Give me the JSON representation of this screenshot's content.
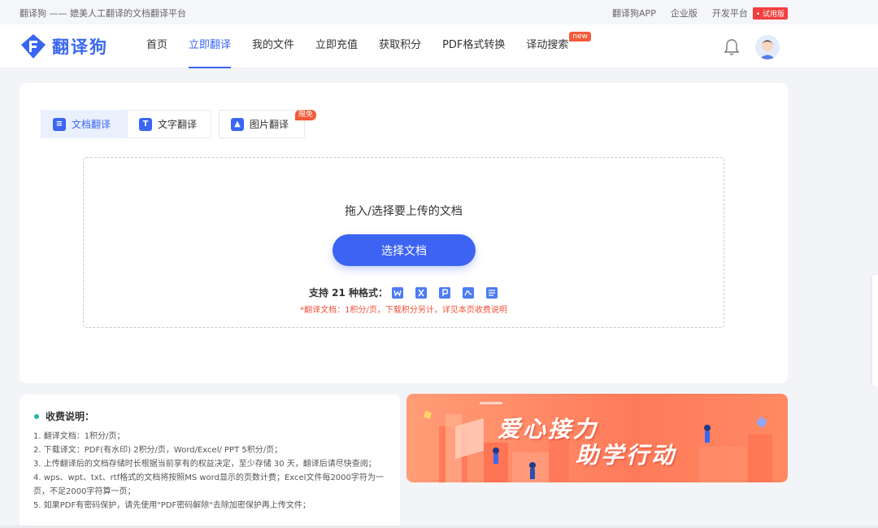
{
  "topbar": {
    "tagline": "翻译狗 —— 媲美人工翻译的文档翻译平台",
    "links": [
      "翻译狗APP",
      "企业版",
      "开发平台"
    ],
    "trial_badge": "• 试用版"
  },
  "nav": {
    "logo_text": "翻译狗",
    "items": [
      {
        "label": "首页",
        "active": false
      },
      {
        "label": "立即翻译",
        "active": true
      },
      {
        "label": "我的文件",
        "active": false
      },
      {
        "label": "立即充值",
        "active": false
      },
      {
        "label": "获取积分",
        "active": false
      },
      {
        "label": "PDF格式转换",
        "active": false
      },
      {
        "label": "译动搜索",
        "active": false,
        "badge": "new"
      }
    ]
  },
  "tabs": [
    {
      "label": "文档翻译",
      "icon": "document-icon",
      "glyph": "≡",
      "selected": true
    },
    {
      "label": "文字翻译",
      "icon": "text-icon",
      "glyph": "T",
      "selected": false
    },
    {
      "label": "图片翻译",
      "icon": "image-icon",
      "glyph": "▲",
      "selected": false,
      "badge": "限免"
    }
  ],
  "upload": {
    "title": "拖入/选择要上传的文档",
    "button": "选择文档",
    "formats_label": "支持 21 种格式：",
    "format_icons": [
      "word-icon",
      "excel-icon",
      "ppt-icon",
      "pdf-icon",
      "txt-icon"
    ],
    "note": "*翻译文档：1积分/页，下载积分另计，详见本页收费说明"
  },
  "fees": {
    "title": "收费说明：",
    "items": [
      "1. 翻译文档：1积分/页；",
      "2. 下载译文：PDF(有水印) 2积分/页，Word/Excel/ PPT 5积分/页；",
      "3. 上传翻译后的文档存储时长根据当前享有的权益决定，至少存储 30 天，翻译后请尽快查阅；",
      "4. wps、wpt、txt、rtf格式的文档将按照MS word显示的页数计费；Excel文件每2000字符为一页，不足2000字符算一页；",
      "5. 如果PDF有密码保护，请先使用\"PDF密码解除\"去除加密保护再上传文件；"
    ]
  },
  "banner": {
    "line1": "爱心接力",
    "line2": "助学行动"
  },
  "colors": {
    "accent": "#3a66f2",
    "badge_red": "#f25a3a",
    "note_red": "#f2503a"
  }
}
